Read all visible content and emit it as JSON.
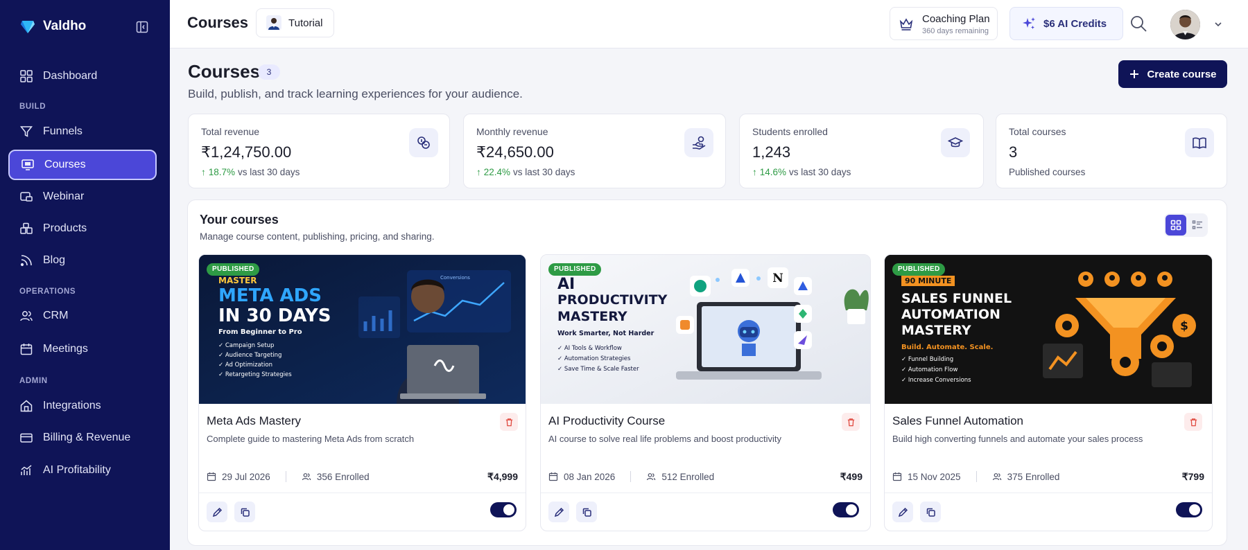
{
  "brand": {
    "name": "Valdho"
  },
  "sidebar": {
    "items": [
      {
        "label": "Dashboard",
        "icon": "grid-icon"
      },
      {
        "label": "Funnels",
        "icon": "funnel-icon"
      },
      {
        "label": "Courses",
        "icon": "monitor-icon",
        "active": true
      },
      {
        "label": "Webinar",
        "icon": "webinar-icon"
      },
      {
        "label": "Products",
        "icon": "products-icon"
      },
      {
        "label": "Blog",
        "icon": "rss-icon"
      },
      {
        "label": "CRM",
        "icon": "users-icon"
      },
      {
        "label": "Meetings",
        "icon": "calendar-icon"
      },
      {
        "label": "Integrations",
        "icon": "home-icon"
      },
      {
        "label": "Billing & Revenue",
        "icon": "card-icon"
      },
      {
        "label": "AI Profitability",
        "icon": "chart-icon"
      }
    ],
    "sections": {
      "build": "BUILD",
      "operations": "OPERATIONS",
      "admin": "ADMIN"
    }
  },
  "topbar": {
    "title": "Courses",
    "tutorial_label": "Tutorial",
    "plan_title": "Coaching Plan",
    "plan_sub": "360 days remaining",
    "credits_label": "$6 AI Credits"
  },
  "header": {
    "title": "Courses",
    "count": "3",
    "subtitle": "Build, publish, and track learning experiences for your audience.",
    "create_label": "Create course"
  },
  "stats": [
    {
      "label": "Total revenue",
      "value": "₹1,24,750.00",
      "pct": "18.7%",
      "foot": "vs last 30 days"
    },
    {
      "label": "Monthly revenue",
      "value": "₹24,650.00",
      "pct": "22.4%",
      "foot": "vs last 30 days"
    },
    {
      "label": "Students enrolled",
      "value": "1,243",
      "pct": "14.6%",
      "foot": "vs last 30 days"
    },
    {
      "label": "Total courses",
      "value": "3",
      "foot": "Published courses"
    }
  ],
  "panel": {
    "title": "Your courses",
    "subtitle": "Manage course content, publishing, pricing, and sharing."
  },
  "courses": [
    {
      "badge": "PUBLISHED",
      "title": "Meta Ads Mastery",
      "desc": "Complete guide to mastering Meta Ads from scratch",
      "date": "29 Jul 2026",
      "enrolled": "356 Enrolled",
      "price": "₹4,999",
      "thumb": {
        "kicker": "MASTER",
        "line1": "META ADS",
        "line2": "IN 30 DAYS",
        "tagline": "From Beginner to Pro",
        "bullets": [
          "Campaign Setup",
          "Audience Targeting",
          "Ad Optimization",
          "Retargeting Strategies"
        ],
        "chart_label": "Conversions"
      }
    },
    {
      "badge": "PUBLISHED",
      "title": "AI Productivity Course",
      "desc": "AI course to solve real life problems and boost productivity",
      "date": "08 Jan 2026",
      "enrolled": "512 Enrolled",
      "price": "₹499",
      "thumb": {
        "line1": "AI",
        "line2": "PRODUCTIVITY",
        "line3": "MASTERY",
        "tagline": "Work Smarter, Not Harder",
        "bullets": [
          "AI Tools & Workflow",
          "Automation Strategies",
          "Save Time & Scale Faster"
        ]
      }
    },
    {
      "badge": "PUBLISHED",
      "title": "Sales Funnel Automation",
      "desc": "Build high converting funnels and automate your sales process",
      "date": "15 Nov 2025",
      "enrolled": "375 Enrolled",
      "price": "₹799",
      "thumb": {
        "kicker": "90 MINUTE",
        "line1": "SALES FUNNEL",
        "line2": "AUTOMATION",
        "line3": "MASTERY",
        "tagline": "Build. Automate. Scale.",
        "bullets": [
          "Funnel Building",
          "Automation Flow",
          "Increase Conversions"
        ]
      }
    }
  ],
  "colors": {
    "sidebar": "#0f1457",
    "accent": "#4b47d8",
    "success": "#2e9b45",
    "danger": "#e0493f"
  }
}
